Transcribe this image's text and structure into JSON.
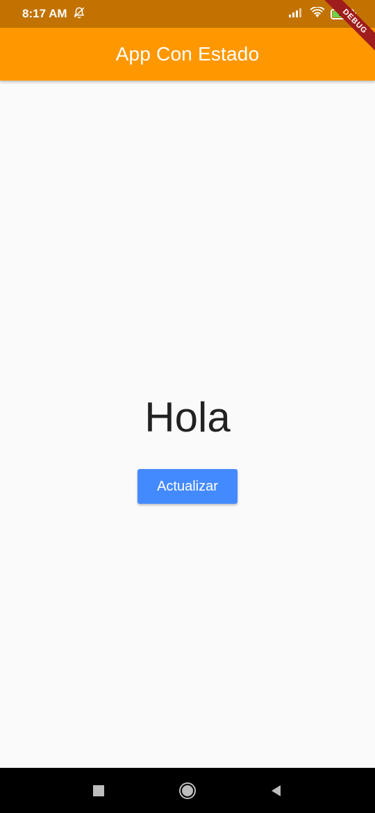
{
  "status_bar": {
    "time": "8:17 AM",
    "icons": [
      "bell-off-icon",
      "signal-icon",
      "wifi-icon",
      "battery-icon"
    ],
    "battery_level": "94"
  },
  "app_bar": {
    "title": "App Con Estado",
    "color": "#ff9800"
  },
  "debug_banner": {
    "label": "DEBUG"
  },
  "main": {
    "greeting": "Hola",
    "button_label": "Actualizar",
    "button_color": "#448aff"
  },
  "nav_bar": {
    "buttons": [
      "recents-square-icon",
      "home-circle-icon",
      "back-triangle-icon"
    ]
  }
}
